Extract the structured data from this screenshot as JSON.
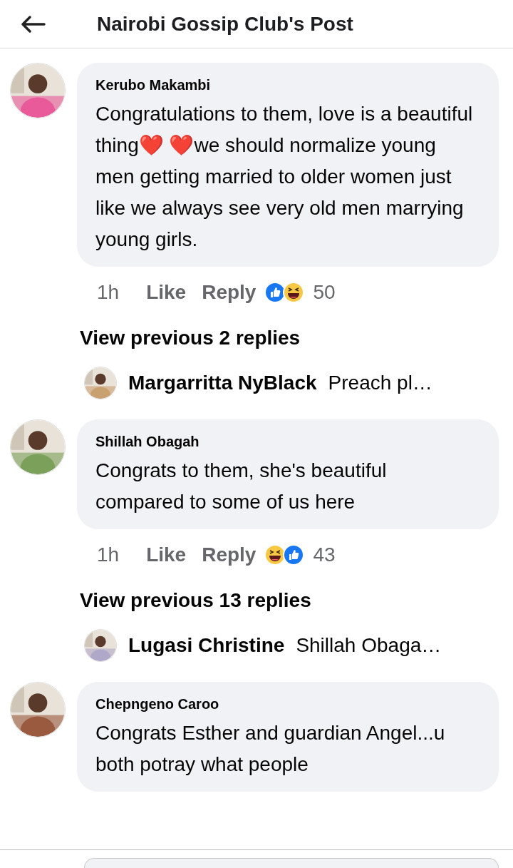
{
  "header": {
    "title": "Nairobi Gossip Club's Post"
  },
  "thread": [
    {
      "kind": "comment",
      "author": "Kerubo Makambi",
      "text": "Congratulations to them, love is a beautiful thing❤️ ❤️we should normalize young men getting married to older women just like we always see very old men marrying young girls.",
      "time": "1h",
      "like": "Like",
      "reply": "Reply",
      "reactions": [
        {
          "kind": "like"
        },
        {
          "kind": "haha"
        }
      ],
      "count": "50"
    },
    {
      "kind": "more",
      "label": "View previous 2 replies"
    },
    {
      "kind": "reply",
      "author": "Margarritta NyBlack",
      "text": "Preach pl…"
    },
    {
      "kind": "comment",
      "author": "Shillah Obagah",
      "text": "Congrats  to them, she's beautiful compared to some of us here",
      "time": "1h",
      "like": "Like",
      "reply": "Reply",
      "reactions": [
        {
          "kind": "haha"
        },
        {
          "kind": "like"
        }
      ],
      "count": "43"
    },
    {
      "kind": "more",
      "label": "View previous 13 replies"
    },
    {
      "kind": "reply",
      "author": "Lugasi Christine",
      "text": "Shillah Obaga…"
    },
    {
      "kind": "comment",
      "author": "Chepngeno Caroo",
      "text": "Congrats Esther and guardian Angel...u both potray what people"
    }
  ]
}
